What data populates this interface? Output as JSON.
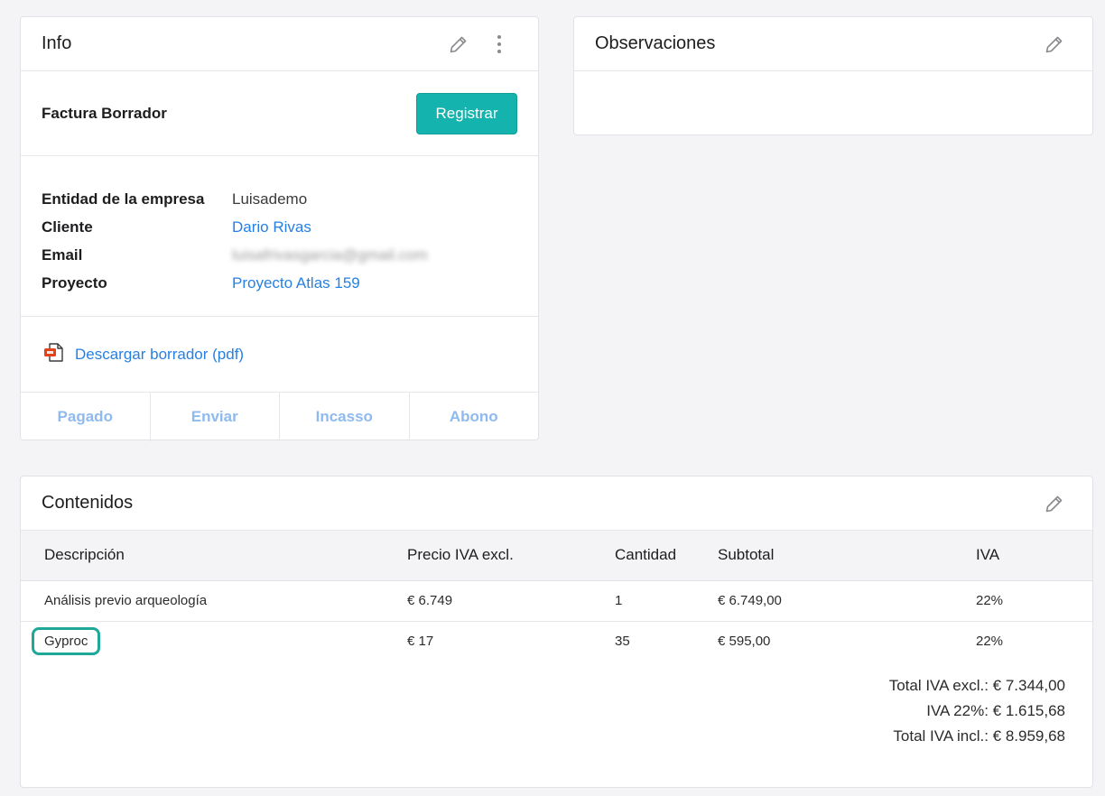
{
  "info": {
    "title": "Info",
    "status_label": "Factura Borrador",
    "register_button": "Registrar",
    "details": [
      {
        "key": "Entidad de la empresa",
        "value": "Luisademo"
      },
      {
        "key": "Cliente",
        "value": "Dario Rivas"
      },
      {
        "key": "Email",
        "value": "luisafrivasgarcia@gmail.com"
      },
      {
        "key": "Proyecto",
        "value": "Proyecto Atlas 159"
      }
    ],
    "download_link": "Descargar borrador (pdf)",
    "actions": [
      "Pagado",
      "Enviar",
      "Incasso",
      "Abono"
    ]
  },
  "observaciones": {
    "title": "Observaciones"
  },
  "contenidos": {
    "title": "Contenidos",
    "columns": [
      "Descripción",
      "Precio IVA excl.",
      "Cantidad",
      "Subtotal",
      "IVA"
    ],
    "rows": [
      {
        "descripcion": "Análisis previo arqueología",
        "precio": "€ 6.749",
        "cantidad": "1",
        "subtotal": "€ 6.749,00",
        "iva": "22%"
      },
      {
        "descripcion": "Gyproc",
        "precio": "€ 17",
        "cantidad": "35",
        "subtotal": "€ 595,00",
        "iva": "22%"
      }
    ],
    "totals": {
      "excl": "Total IVA excl.: € 7.344,00",
      "iva": "IVA 22%: € 1.615,68",
      "incl": "Total IVA incl.: € 8.959,68"
    }
  },
  "colors": {
    "primary": "#14b3ad",
    "link": "#2680e3",
    "action_disabled": "#8fbaf0",
    "highlight": "#1fa89a"
  },
  "icons": [
    "pencil-icon",
    "more-vertical-icon",
    "pdf-icon"
  ]
}
